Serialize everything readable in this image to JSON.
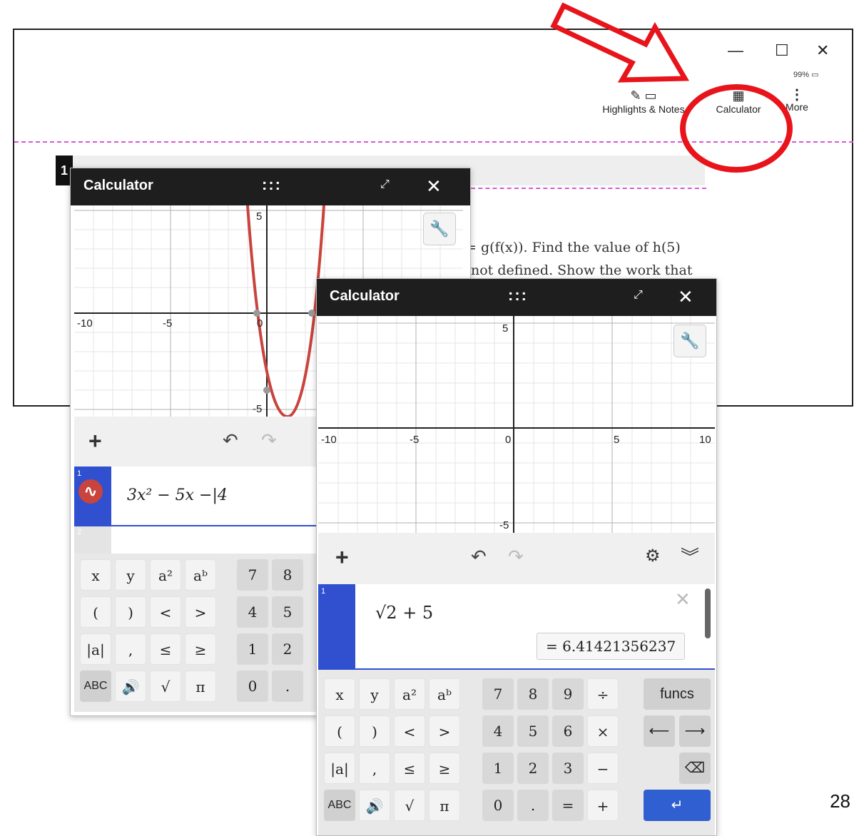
{
  "window": {
    "minimize_glyph": "—",
    "maximize_glyph": "☐",
    "close_glyph": "✕",
    "battery_text": "99%",
    "toolbar": {
      "highlights_label": "Highlights & Notes",
      "calculator_label": "Calculator",
      "more_label": "More"
    },
    "question_number": "1",
    "question_line1": "= g(f(x)). Find the value of h(5)",
    "question_line2": "not defined. Show the work that"
  },
  "annotation": {
    "color": "#e8141b",
    "shapes": [
      "arrow",
      "circle"
    ]
  },
  "calc_back": {
    "title": "Calculator",
    "grip": ":::",
    "expand_icon": "⤢",
    "close_icon": "✕",
    "axis_labels": {
      "y_top": "5",
      "x_left": "-10",
      "x_mid": "-5",
      "origin": "0",
      "y_bottom": "-5"
    },
    "expression": {
      "index": "1",
      "text": "3x² − 5x −|4"
    },
    "row2_index": "2",
    "keys": [
      [
        "x",
        "y",
        "a²",
        "aᵇ",
        "7",
        "8"
      ],
      [
        "(",
        ")",
        "<",
        ">",
        "4",
        "5"
      ],
      [
        "|a|",
        ",",
        "≤",
        "≥",
        "1",
        "2"
      ],
      [
        "ABC",
        "🔊",
        "√",
        "π",
        "0",
        "."
      ]
    ],
    "curve_color": "#c8443c"
  },
  "calc_front": {
    "title": "Calculator",
    "grip": ":::",
    "expand_icon": "⤢",
    "close_icon": "✕",
    "axis_labels": {
      "y_top": "5",
      "x_left": "-10",
      "x_mid": "-5",
      "origin": "0",
      "x_pos": "5",
      "x_right": "10",
      "y_bottom": "-5"
    },
    "expression": {
      "index": "1",
      "text": "√2 + 5",
      "result": "= 6.41421356237"
    },
    "keys_left": [
      [
        "x",
        "y",
        "a²",
        "aᵇ"
      ],
      [
        "(",
        ")",
        "<",
        ">"
      ],
      [
        "|a|",
        ",",
        "≤",
        "≥"
      ],
      [
        "ABC",
        "🔊",
        "√",
        "π"
      ]
    ],
    "keys_num": [
      [
        "7",
        "8",
        "9",
        "÷"
      ],
      [
        "4",
        "5",
        "6",
        "×"
      ],
      [
        "1",
        "2",
        "3",
        "−"
      ],
      [
        "0",
        ".",
        "=",
        "+"
      ]
    ],
    "funcs_label": "funcs",
    "accent_color": "#3050d0"
  },
  "page_number": "28"
}
